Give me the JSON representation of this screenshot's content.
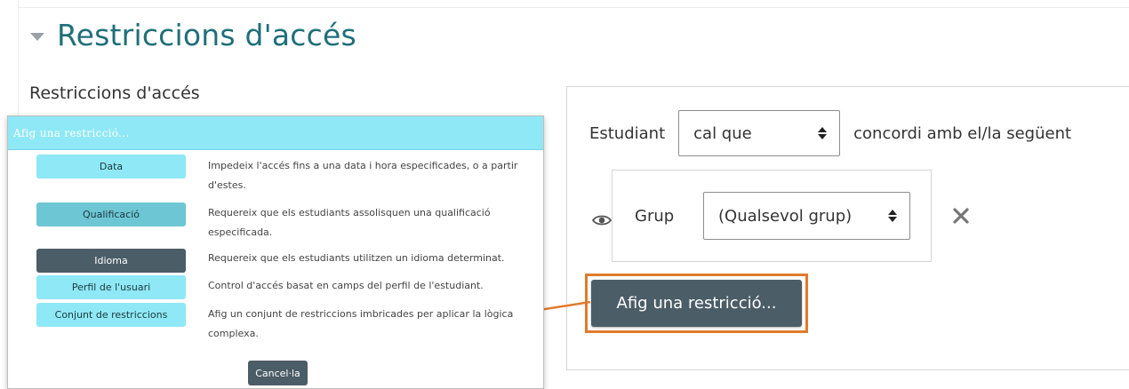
{
  "section": {
    "title": "Restriccions d'accés"
  },
  "subtitle": "Restriccions d'accés",
  "restriction": {
    "student_label": "Estudiant",
    "match_select": "cal que",
    "match_suffix": "concordi amb el/la següent",
    "condition_label": "Grup",
    "group_select": "(Qualsevol grup)",
    "add_button": "Afig una restricció..."
  },
  "modal": {
    "title": "Afig una restricció...",
    "items": [
      {
        "label": "Data",
        "description": "Impedeix l'accés fins a una data i hora especificades, o a partir d'estes."
      },
      {
        "label": "Qualificació",
        "description": "Requereix que els estudiants assolisquen una qualificació especificada."
      },
      {
        "label": "Idioma",
        "description": "Requereix que els estudiants utilitzen un idioma determinat."
      },
      {
        "label": "Perfil de l'usuari",
        "description": "Control d'accés basat en camps del perfil de l'estudiant."
      },
      {
        "label": "Conjunt de restriccions",
        "description": "Afig un conjunt de restriccions imbricades per aplicar la lògica complexa."
      }
    ],
    "cancel_button": "Cancel·la"
  },
  "colors": {
    "title_teal": "#1f6f7a",
    "modal_header": "#8ee8f5",
    "button_dark": "#4b5d66",
    "highlight_orange": "#e07b2c"
  },
  "icons": [
    "chevron-down-icon",
    "eye-icon",
    "close-icon",
    "select-arrows-icon"
  ]
}
